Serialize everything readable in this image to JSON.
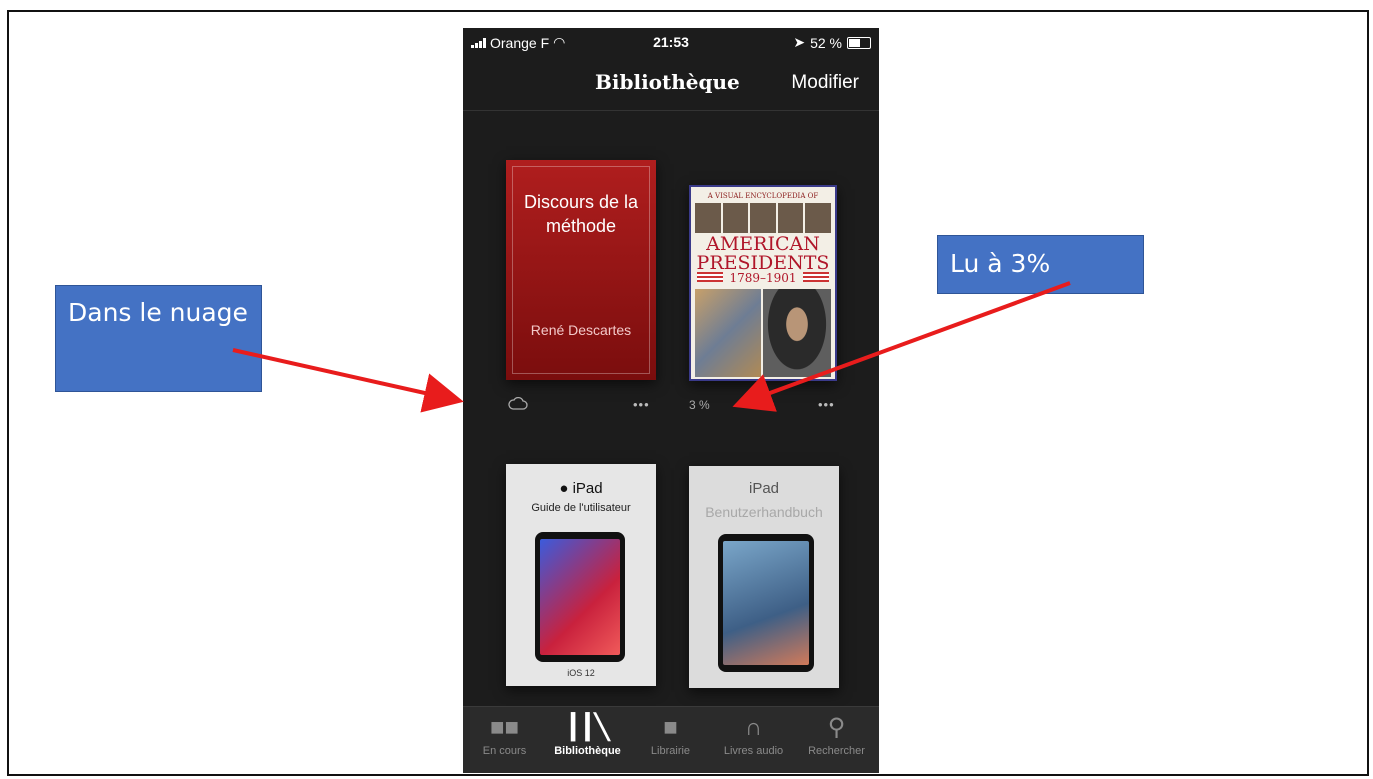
{
  "status_bar": {
    "carrier": "Orange F",
    "time": "21:53",
    "battery": "52 %"
  },
  "nav": {
    "title": "Bibliothèque",
    "edit_label": "Modifier"
  },
  "books": [
    {
      "title": "Discours de la méthode",
      "author": "René Descartes"
    },
    {
      "cover_super": "A VISUAL ENCYCLOPEDIA OF",
      "cover_title_1": "AMERICAN",
      "cover_title_2": "PRESIDENTS",
      "cover_years": "1789–1901",
      "progress": "3 %"
    },
    {
      "brand": "iPad",
      "subtitle": "Guide de l'utilisateur",
      "footer": "iOS 12"
    },
    {
      "brand": "iPad",
      "subtitle": "Benutzerhandbuch"
    }
  ],
  "more_glyph": "•••",
  "tabs": [
    {
      "label": "En cours",
      "icon": "book-open-icon"
    },
    {
      "label": "Bibliothèque",
      "icon": "library-icon",
      "active": true
    },
    {
      "label": "Librairie",
      "icon": "shopping-bag-icon"
    },
    {
      "label": "Livres audio",
      "icon": "headphones-icon"
    },
    {
      "label": "Rechercher",
      "icon": "search-icon"
    }
  ],
  "annotations": {
    "cloud": "Dans le nuage",
    "read": "Lu à 3%"
  },
  "colors": {
    "annotation_box": "#4472c4",
    "arrow": "#e81c1c",
    "phone_bg": "#1c1c1c"
  }
}
